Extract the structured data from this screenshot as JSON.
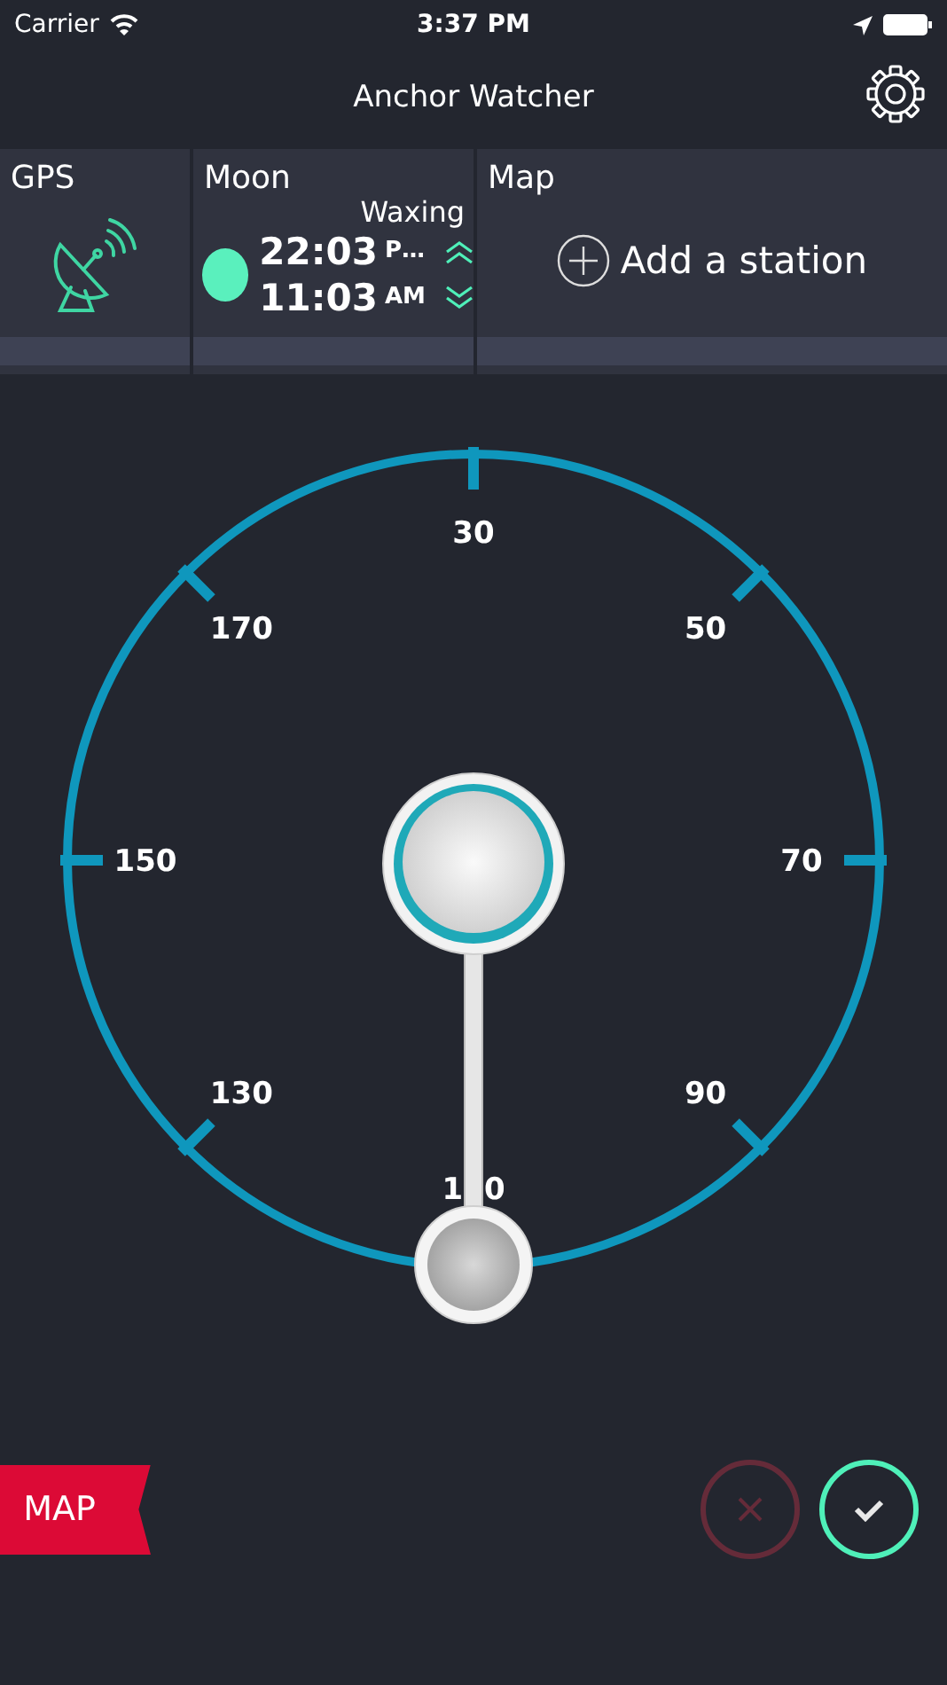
{
  "status_bar": {
    "carrier": "Carrier",
    "time": "3:37 PM"
  },
  "nav": {
    "title": "Anchor Watcher"
  },
  "tiles": [
    {
      "kind": "gps",
      "title": "GPS"
    },
    {
      "kind": "moon",
      "title": "Moon",
      "phase": "Waxing",
      "rise": {
        "time": "22:03",
        "suffix": "P…"
      },
      "set": {
        "time": "11:03",
        "suffix": "AM"
      }
    },
    {
      "kind": "map",
      "title": "Map",
      "action": "Add a station"
    }
  ],
  "dial": {
    "labels": [
      "30",
      "50",
      "70",
      "90",
      "1 0",
      "130",
      "150",
      "170"
    ]
  },
  "map_tag": "MAP",
  "buttons": {
    "cancel": {
      "disabled": true
    },
    "confirm": {
      "disabled": false
    }
  }
}
